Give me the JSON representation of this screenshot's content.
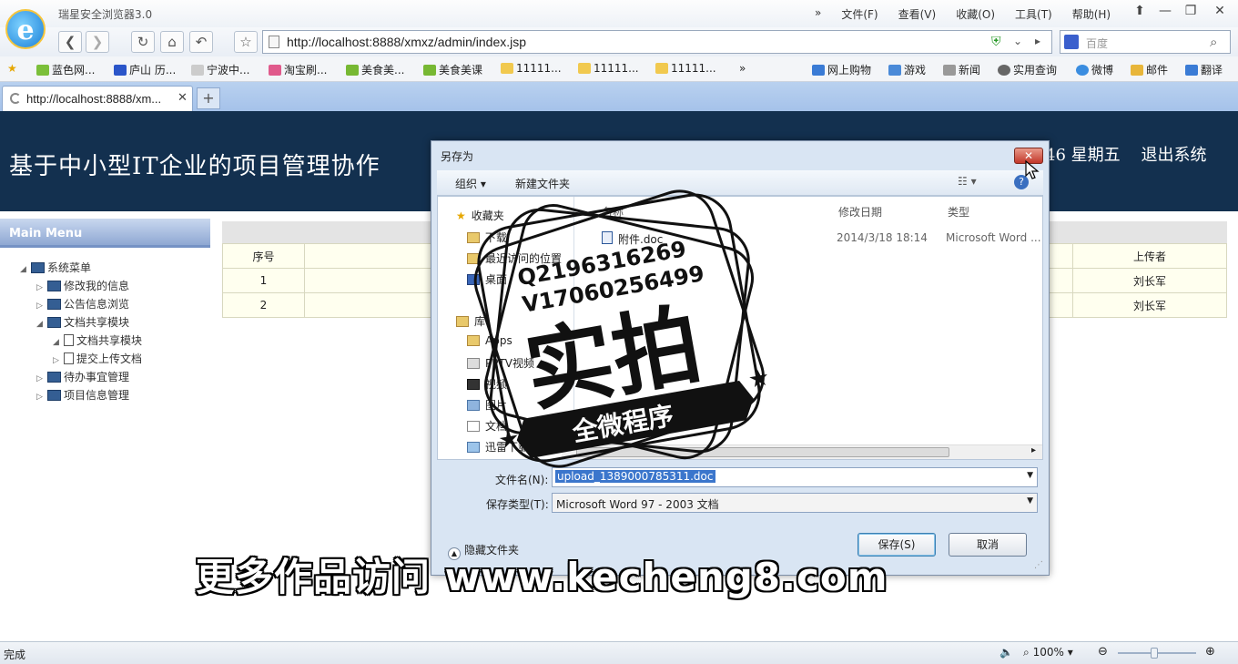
{
  "browser": {
    "app_title": "瑞星安全浏览器3.0",
    "menu": [
      "»",
      "文件(F)",
      "查看(V)",
      "收藏(O)",
      "工具(T)",
      "帮助(H)"
    ],
    "address": "http://localhost:8888/xmxz/admin/index.jsp",
    "search_placeholder": "百度",
    "bookmarks_left": [
      "蓝色网...",
      "庐山 历...",
      "宁波中...",
      "淘宝刷...",
      "美食美...",
      "美食美课",
      "11111...",
      "11111...",
      "11111..."
    ],
    "bookmarks_right": [
      "网上购物",
      "游戏",
      "新闻",
      "实用查询",
      "微博",
      "邮件",
      "翻译"
    ],
    "tab_title": "http://localhost:8888/xm...",
    "new_tab": "+",
    "status_left": "完成",
    "zoom": "100%"
  },
  "page": {
    "header_title": "基于中小型IT企业的项目管理协作",
    "header_date_fragment": "46 星期五",
    "logout": "退出系统",
    "menu_title": "Main Menu",
    "tree": [
      {
        "label": "系统菜单",
        "level": 0,
        "icon": "folder-icon",
        "expanded": true
      },
      {
        "label": "修改我的信息",
        "level": 1,
        "icon": "folder-icon",
        "expanded": false
      },
      {
        "label": "公告信息浏览",
        "level": 1,
        "icon": "folder-icon",
        "expanded": false
      },
      {
        "label": "文档共享模块",
        "level": 1,
        "icon": "folder-icon",
        "expanded": true
      },
      {
        "label": "文档共享模块",
        "level": 2,
        "icon": "document-icon",
        "expanded": true
      },
      {
        "label": "提交上传文档",
        "level": 2,
        "icon": "document-icon",
        "expanded": false
      },
      {
        "label": "待办事宜管理",
        "level": 1,
        "icon": "folder-icon",
        "expanded": false
      },
      {
        "label": "项目信息管理",
        "level": 1,
        "icon": "folder-icon",
        "expanded": false
      }
    ],
    "table": {
      "col_index": "序号",
      "col_uploader": "上传者",
      "rows": [
        {
          "index": "1",
          "uploader": "刘长军"
        },
        {
          "index": "2",
          "uploader": "刘长军"
        }
      ]
    }
  },
  "dialog": {
    "title": "另存为",
    "toolbar_organize": "组织 ▾",
    "toolbar_new_folder": "新建文件夹",
    "nav": {
      "favorites": "收藏夹",
      "fav_items": [
        "下载",
        "最近访问的位置",
        "桌面"
      ],
      "library": "库",
      "lib_items": [
        "Apps",
        "PPTV视频",
        "视频",
        "图片",
        "文档",
        "迅雷下载"
      ]
    },
    "columns": {
      "name": "名称",
      "modified": "修改日期",
      "type": "类型"
    },
    "file": {
      "name": "附件.doc",
      "modified": "2014/3/18 18:14",
      "type": "Microsoft Word ..."
    },
    "filename_label": "文件名(N):",
    "filename_value": "upload_1389000785311.doc",
    "filetype_label": "保存类型(T):",
    "filetype_value": "Microsoft Word 97 - 2003 文档",
    "hide_folders": "隐藏文件夹",
    "save_button": "保存(S)",
    "cancel_button": "取消"
  },
  "overlay": {
    "stamp_line1": "Q2196316269",
    "stamp_line2": "V17060256499",
    "stamp_big": "实拍",
    "stamp_banner": "全微程序",
    "watermark": "更多作品访问 www.kecheng8.com"
  }
}
